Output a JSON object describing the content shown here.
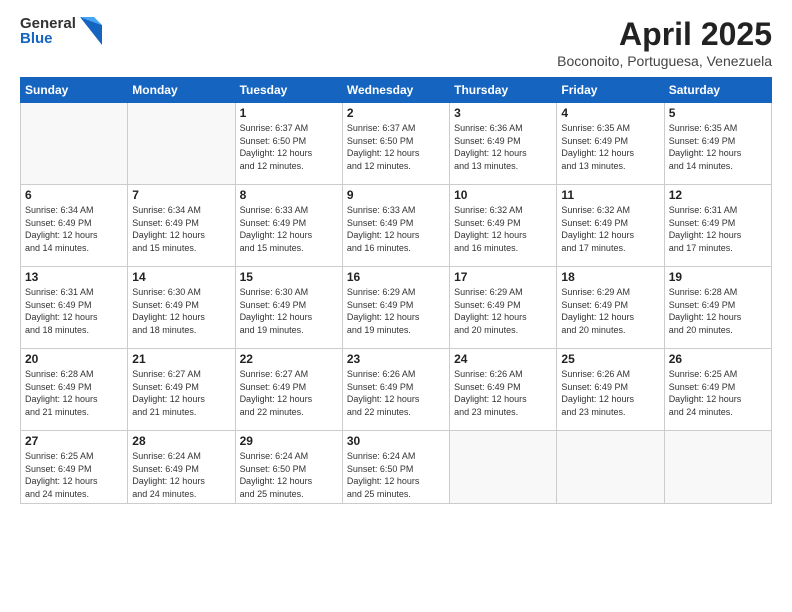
{
  "logo": {
    "general": "General",
    "blue": "Blue"
  },
  "title": {
    "month_year": "April 2025",
    "location": "Boconoito, Portuguesa, Venezuela"
  },
  "days_of_week": [
    "Sunday",
    "Monday",
    "Tuesday",
    "Wednesday",
    "Thursday",
    "Friday",
    "Saturday"
  ],
  "weeks": [
    [
      {
        "day": "",
        "info": ""
      },
      {
        "day": "",
        "info": ""
      },
      {
        "day": "1",
        "info": "Sunrise: 6:37 AM\nSunset: 6:50 PM\nDaylight: 12 hours\nand 12 minutes."
      },
      {
        "day": "2",
        "info": "Sunrise: 6:37 AM\nSunset: 6:50 PM\nDaylight: 12 hours\nand 12 minutes."
      },
      {
        "day": "3",
        "info": "Sunrise: 6:36 AM\nSunset: 6:49 PM\nDaylight: 12 hours\nand 13 minutes."
      },
      {
        "day": "4",
        "info": "Sunrise: 6:35 AM\nSunset: 6:49 PM\nDaylight: 12 hours\nand 13 minutes."
      },
      {
        "day": "5",
        "info": "Sunrise: 6:35 AM\nSunset: 6:49 PM\nDaylight: 12 hours\nand 14 minutes."
      }
    ],
    [
      {
        "day": "6",
        "info": "Sunrise: 6:34 AM\nSunset: 6:49 PM\nDaylight: 12 hours\nand 14 minutes."
      },
      {
        "day": "7",
        "info": "Sunrise: 6:34 AM\nSunset: 6:49 PM\nDaylight: 12 hours\nand 15 minutes."
      },
      {
        "day": "8",
        "info": "Sunrise: 6:33 AM\nSunset: 6:49 PM\nDaylight: 12 hours\nand 15 minutes."
      },
      {
        "day": "9",
        "info": "Sunrise: 6:33 AM\nSunset: 6:49 PM\nDaylight: 12 hours\nand 16 minutes."
      },
      {
        "day": "10",
        "info": "Sunrise: 6:32 AM\nSunset: 6:49 PM\nDaylight: 12 hours\nand 16 minutes."
      },
      {
        "day": "11",
        "info": "Sunrise: 6:32 AM\nSunset: 6:49 PM\nDaylight: 12 hours\nand 17 minutes."
      },
      {
        "day": "12",
        "info": "Sunrise: 6:31 AM\nSunset: 6:49 PM\nDaylight: 12 hours\nand 17 minutes."
      }
    ],
    [
      {
        "day": "13",
        "info": "Sunrise: 6:31 AM\nSunset: 6:49 PM\nDaylight: 12 hours\nand 18 minutes."
      },
      {
        "day": "14",
        "info": "Sunrise: 6:30 AM\nSunset: 6:49 PM\nDaylight: 12 hours\nand 18 minutes."
      },
      {
        "day": "15",
        "info": "Sunrise: 6:30 AM\nSunset: 6:49 PM\nDaylight: 12 hours\nand 19 minutes."
      },
      {
        "day": "16",
        "info": "Sunrise: 6:29 AM\nSunset: 6:49 PM\nDaylight: 12 hours\nand 19 minutes."
      },
      {
        "day": "17",
        "info": "Sunrise: 6:29 AM\nSunset: 6:49 PM\nDaylight: 12 hours\nand 20 minutes."
      },
      {
        "day": "18",
        "info": "Sunrise: 6:29 AM\nSunset: 6:49 PM\nDaylight: 12 hours\nand 20 minutes."
      },
      {
        "day": "19",
        "info": "Sunrise: 6:28 AM\nSunset: 6:49 PM\nDaylight: 12 hours\nand 20 minutes."
      }
    ],
    [
      {
        "day": "20",
        "info": "Sunrise: 6:28 AM\nSunset: 6:49 PM\nDaylight: 12 hours\nand 21 minutes."
      },
      {
        "day": "21",
        "info": "Sunrise: 6:27 AM\nSunset: 6:49 PM\nDaylight: 12 hours\nand 21 minutes."
      },
      {
        "day": "22",
        "info": "Sunrise: 6:27 AM\nSunset: 6:49 PM\nDaylight: 12 hours\nand 22 minutes."
      },
      {
        "day": "23",
        "info": "Sunrise: 6:26 AM\nSunset: 6:49 PM\nDaylight: 12 hours\nand 22 minutes."
      },
      {
        "day": "24",
        "info": "Sunrise: 6:26 AM\nSunset: 6:49 PM\nDaylight: 12 hours\nand 23 minutes."
      },
      {
        "day": "25",
        "info": "Sunrise: 6:26 AM\nSunset: 6:49 PM\nDaylight: 12 hours\nand 23 minutes."
      },
      {
        "day": "26",
        "info": "Sunrise: 6:25 AM\nSunset: 6:49 PM\nDaylight: 12 hours\nand 24 minutes."
      }
    ],
    [
      {
        "day": "27",
        "info": "Sunrise: 6:25 AM\nSunset: 6:49 PM\nDaylight: 12 hours\nand 24 minutes."
      },
      {
        "day": "28",
        "info": "Sunrise: 6:24 AM\nSunset: 6:49 PM\nDaylight: 12 hours\nand 24 minutes."
      },
      {
        "day": "29",
        "info": "Sunrise: 6:24 AM\nSunset: 6:50 PM\nDaylight: 12 hours\nand 25 minutes."
      },
      {
        "day": "30",
        "info": "Sunrise: 6:24 AM\nSunset: 6:50 PM\nDaylight: 12 hours\nand 25 minutes."
      },
      {
        "day": "",
        "info": ""
      },
      {
        "day": "",
        "info": ""
      },
      {
        "day": "",
        "info": ""
      }
    ]
  ]
}
